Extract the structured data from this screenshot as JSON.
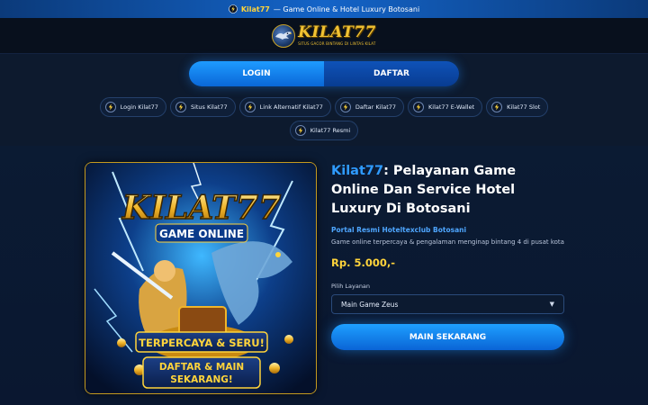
{
  "topbar": {
    "brand": "Kilat77",
    "text": "— Game Online & Hotel Luxury Botosani",
    "icon": "lightning-badge-icon"
  },
  "header": {
    "logo_word": "KILAT77",
    "logo_tagline": "SITUS GACOR BINTANG DI LINTAS KILAT",
    "logo_icon": "eagle-icon"
  },
  "auth": {
    "login_label": "LOGIN",
    "daftar_label": "DAFTAR"
  },
  "chips": [
    {
      "label": "Login Kilat77",
      "icon": "lightning-badge-icon"
    },
    {
      "label": "Situs Kilat77",
      "icon": "lightning-badge-icon"
    },
    {
      "label": "Link Alternatif Kilat77",
      "icon": "lightning-badge-icon"
    },
    {
      "label": "Daftar Kilat77",
      "icon": "lightning-badge-icon"
    },
    {
      "label": "Kilat77 E-Wallet",
      "icon": "lightning-badge-icon"
    },
    {
      "label": "Kilat77 Slot",
      "icon": "lightning-badge-icon"
    },
    {
      "label": "Kilat77 Resmi",
      "icon": "lightning-badge-icon"
    }
  ],
  "banner": {
    "logo_text": "KILAT77",
    "game_online": "GAME ONLINE",
    "ribbon_1": "TERPERCAYA & SERU!",
    "ribbon_2_line1": "DAFTAR & MAIN",
    "ribbon_2_line2": "SEKARANG!"
  },
  "product": {
    "title_highlight": "Kilat77",
    "title_rest": ": Pelayanan Game Online Dan Service Hotel Luxury Di Botosani",
    "subtitle": "Portal Resmi Hoteltexclub Botosani",
    "description": "Game online terpercaya & pengalaman menginap bintang 4 di pusat kota",
    "price": "Rp. 5.000,-",
    "select_label": "Pilih Layanan",
    "select_value": "Main Game Zeus",
    "play_label": "MAIN SEKARANG"
  },
  "colors": {
    "accent_blue": "#1e9bff",
    "gold": "#ffd43b",
    "background": "#0b1424"
  }
}
